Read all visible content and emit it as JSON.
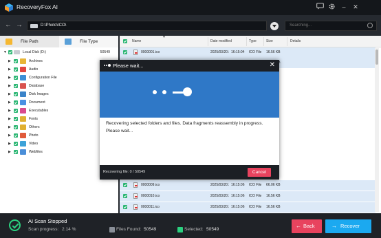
{
  "app": {
    "title": "RecoveryFox AI",
    "colors": {
      "accent": "#1ba9f0",
      "danger": "#e8435e",
      "success": "#2bd07f",
      "modal_band": "#2f78c7"
    }
  },
  "titlebar": {
    "icons": [
      "chat-icon",
      "gear-icon",
      "minimize-icon",
      "close-icon"
    ],
    "min_glyph": "–",
    "close_glyph": "✕"
  },
  "navbar": {
    "back_glyph": "←",
    "forward_glyph": "→",
    "path": "D:\\Photo\\ICO\\",
    "search_placeholder": "Searching..."
  },
  "left_panel": {
    "tabs": [
      {
        "label": "File Path",
        "icon": "folder-icon"
      },
      {
        "label": "File Type",
        "icon": "image-icon"
      }
    ],
    "root": {
      "label": "Local Disk (D:)",
      "count": "50549"
    },
    "items": [
      {
        "label": "Archives",
        "icon": "archives-icon",
        "color": "#e8b537"
      },
      {
        "label": "Audio",
        "icon": "audio-icon",
        "color": "#e2463f"
      },
      {
        "label": "Configuration File",
        "icon": "config-icon",
        "color": "#3c8fd6"
      },
      {
        "label": "Database",
        "icon": "database-icon",
        "color": "#d9534f"
      },
      {
        "label": "Disk Images",
        "icon": "disk-image-icon",
        "color": "#3a83c9"
      },
      {
        "label": "Document",
        "icon": "document-icon",
        "color": "#4a90e2"
      },
      {
        "label": "Executables",
        "icon": "executables-icon",
        "color": "#d94a8c"
      },
      {
        "label": "Fonts",
        "icon": "fonts-icon",
        "color": "#e0b030"
      },
      {
        "label": "Others",
        "icon": "others-icon",
        "color": "#e0b030"
      },
      {
        "label": "Photo",
        "icon": "photo-icon",
        "color": "#e05a3a"
      },
      {
        "label": "Video",
        "icon": "video-icon",
        "color": "#3ca2d8"
      },
      {
        "label": "Webfiles",
        "icon": "webfiles-icon",
        "color": "#4a8ed8"
      }
    ]
  },
  "file_list": {
    "columns": [
      "Name",
      "Date modified",
      "Type",
      "Size",
      "Details"
    ],
    "rows": [
      {
        "name": "0000001.ico",
        "date": "2025/03/20：16:15:04",
        "type": "ICO File",
        "size": "16.56 KB"
      },
      {
        "name": "0000002.ico",
        "date": "2025/03/20：16:15:04",
        "type": "ICO File",
        "size": "16.56 KB"
      },
      {
        "name": "0000009.ico",
        "date": "2025/03/20：16:15:06",
        "type": "ICO File",
        "size": "66.06 KB"
      },
      {
        "name": "0000010.ico",
        "date": "2025/03/20：16:15:06",
        "type": "ICO File",
        "size": "16.56 KB"
      },
      {
        "name": "0000011.ico",
        "date": "2025/03/20：16:15:06",
        "type": "ICO File",
        "size": "16.56 KB"
      }
    ]
  },
  "modal": {
    "title": "Please wait...",
    "message": "Recovering selected folders and files. Data fragments reassembly in progress. Please wait...",
    "progress_text": "Recovering file: 0 / 50549",
    "cancel_label": "Cancel",
    "close_glyph": "✕"
  },
  "status": {
    "title": "AI Scan Stopped",
    "progress_label": "Scan progress:",
    "progress_value": "2.14 %",
    "files_found_label": "Files Found:",
    "files_found_value": "50549",
    "selected_label": "Selected:",
    "selected_value": "50549",
    "back_label": "Back",
    "back_glyph": "←",
    "recover_label": "Recover",
    "recover_glyph": "→"
  }
}
